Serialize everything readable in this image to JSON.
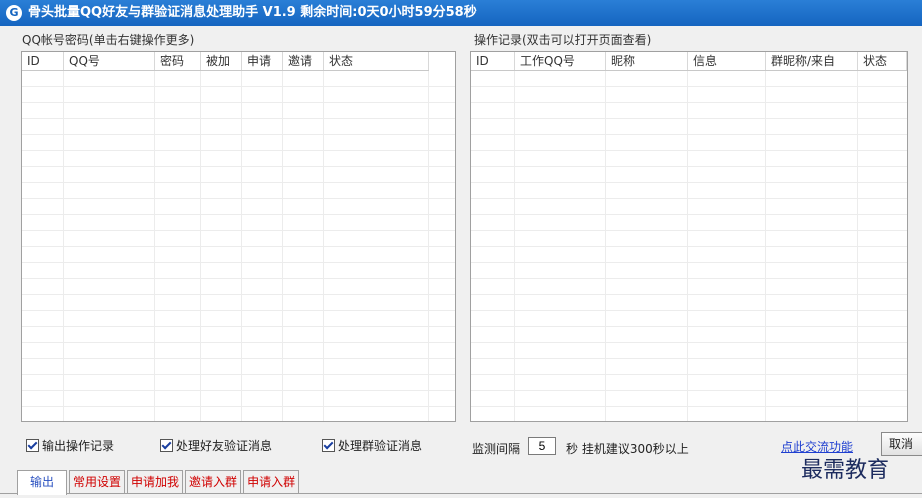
{
  "window": {
    "title_icon": "G",
    "title": "骨头批量QQ好友与群验证消息处理助手 V1.9 剩余时间:0天0小时59分58秒"
  },
  "left_panel": {
    "label": "QQ帐号密码(单击右键操作更多)",
    "columns": [
      "ID",
      "QQ号",
      "密码",
      "被加",
      "申请",
      "邀请",
      "状态"
    ],
    "rows": []
  },
  "right_panel": {
    "label": "操作记录(双击可以打开页面查看)",
    "columns": [
      "ID",
      "工作QQ号",
      "昵称",
      "信息",
      "群昵称/来自",
      "状态"
    ],
    "rows": []
  },
  "options": [
    {
      "label": "输出操作记录",
      "checked": true
    },
    {
      "label": "处理好友验证消息",
      "checked": true
    },
    {
      "label": "处理群验证消息",
      "checked": true
    }
  ],
  "monitor": {
    "label": "监测间隔",
    "value": "5",
    "unit": "秒 挂机建议300秒以上"
  },
  "link_text": "点此交流功能",
  "cut_button": "取消",
  "tabs": [
    "输出",
    "常用设置",
    "申请加我",
    "邀请入群",
    "申请入群"
  ],
  "watermark": "最需教育",
  "colors": {
    "titlebar": "#1565c0",
    "tab_text": "#d00000",
    "link": "#1f3fd0"
  }
}
